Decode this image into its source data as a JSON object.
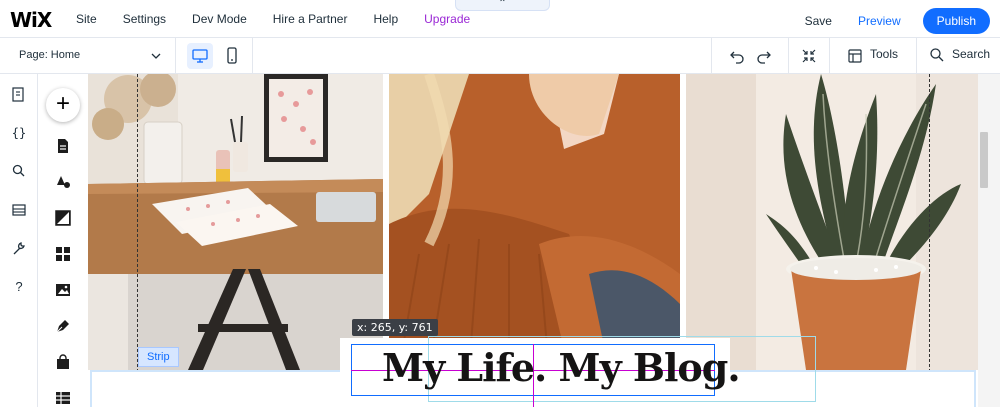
{
  "app": {
    "logo": "WiX"
  },
  "topnav": {
    "items": [
      "Site",
      "Settings",
      "Dev Mode",
      "Hire a Partner",
      "Help"
    ],
    "upgrade": "Upgrade",
    "handle": "⌃"
  },
  "topright": {
    "save": "Save",
    "preview": "Preview",
    "publish": "Publish"
  },
  "toolbar": {
    "page_label": "Page: Home",
    "tools": "Tools",
    "search": "Search"
  },
  "canvas": {
    "strip_label": "Strip",
    "coord_readout": "x: 265, y: 761",
    "headline": "My Life. My Blog."
  },
  "colors": {
    "accent": "#116dff",
    "upgrade": "#9a27d5",
    "selection": "#116dff",
    "guide": "#c800d2"
  }
}
